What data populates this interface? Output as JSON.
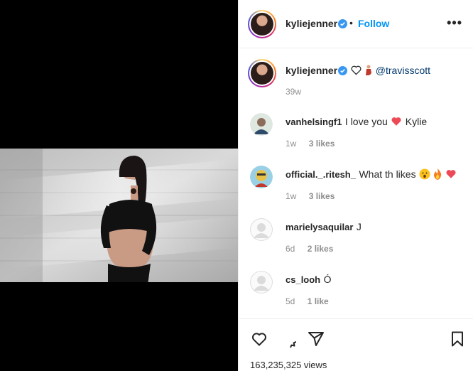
{
  "post": {
    "username": "kyliejenner",
    "follow_label": "Follow",
    "dot": "•",
    "more_label": "•••",
    "caption": {
      "username": "kyliejenner",
      "mention": "@travisscott",
      "time": "39w"
    }
  },
  "comments": [
    {
      "username": "vanhelsingf1",
      "text": "I love you",
      "text_after": "Kylie",
      "time": "1w",
      "likes": "3 likes"
    },
    {
      "username": "official._.ritesh_",
      "text": "What th likes",
      "time": "1w",
      "likes": "3 likes"
    },
    {
      "username": "marielysaquilar",
      "text": "J",
      "time": "6d",
      "likes": "2 likes"
    },
    {
      "username": "cs_looh",
      "text": "Ó",
      "time": "5d",
      "likes": "1 like"
    }
  ],
  "footer": {
    "views": "163,235,325 views"
  },
  "colors": {
    "follow_blue": "#0095f6",
    "verified_blue": "#3897f0",
    "heart_red": "#ed4956",
    "muted": "#8e8e8e"
  },
  "icons": [
    "heart-icon",
    "comment-icon",
    "share-icon",
    "bookmark-icon",
    "verified-badge-icon",
    "more-options-icon"
  ]
}
